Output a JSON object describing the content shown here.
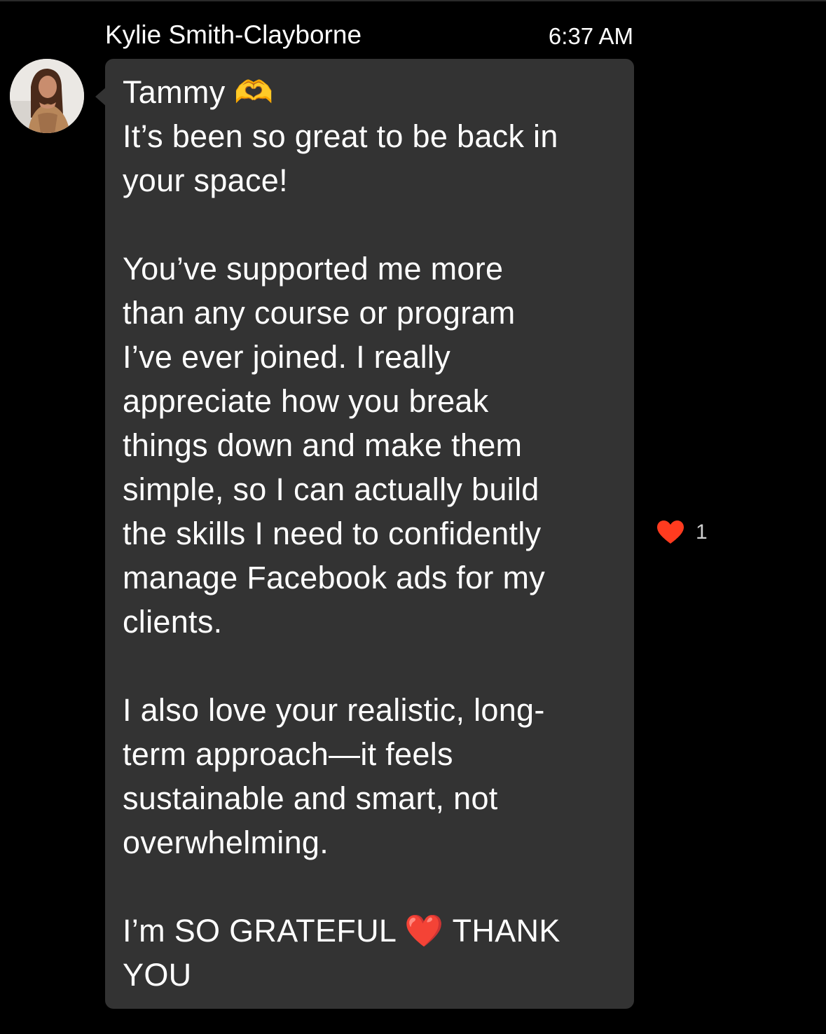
{
  "message": {
    "sender": "Kylie Smith-Clayborne",
    "time": "6:37 AM",
    "avatar_icon": "profile-photo",
    "lines": [
      "Tammy 🫶",
      "It’s been so great to be back in",
      "your space!",
      "",
      "You’ve supported me more",
      "than any course or program",
      "I’ve ever joined. I really",
      "appreciate how you break",
      "things down and make them",
      "simple, so I can actually build",
      "the skills I need to confidently",
      "manage Facebook ads for my",
      "clients.",
      "",
      "I also love your realistic, long-",
      "term approach—it feels",
      "sustainable and smart, not",
      "overwhelming.",
      "",
      "I’m SO GRATEFUL ❤️ THANK",
      "YOU"
    ]
  },
  "reaction": {
    "icon": "heart-icon",
    "color": "#ff3b1f",
    "count": "1"
  },
  "colors": {
    "background": "#000000",
    "bubble": "#333333",
    "text": "#ffffff"
  }
}
